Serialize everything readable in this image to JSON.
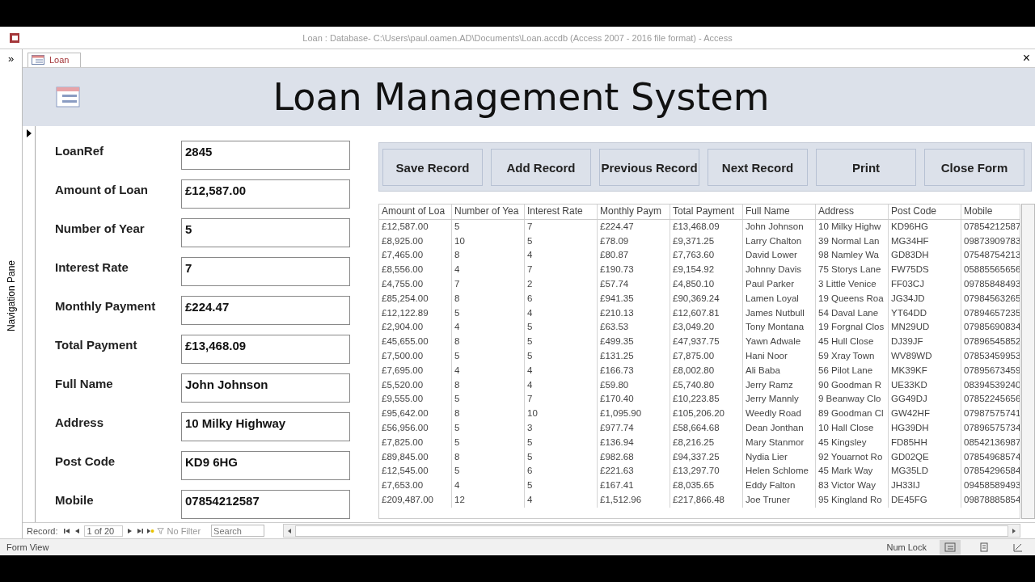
{
  "window": {
    "title": "Loan : Database- C:\\Users\\paul.oamen.AD\\Documents\\Loan.accdb (Access 2007 - 2016 file format) - Access"
  },
  "navigation_pane": {
    "label": "Navigation Pane",
    "toggle": "»"
  },
  "tabs": [
    {
      "label": "Loan",
      "selected": true
    }
  ],
  "close_tab": "×",
  "form": {
    "title": "Loan Management System",
    "fields": [
      {
        "label": "LoanRef",
        "value": "2845"
      },
      {
        "label": "Amount of Loan",
        "value": "£12,587.00"
      },
      {
        "label": "Number of Year",
        "value": "5"
      },
      {
        "label": "Interest Rate",
        "value": "7"
      },
      {
        "label": "Monthly Payment",
        "value": "£224.47"
      },
      {
        "label": "Total Payment",
        "value": "£13,468.09"
      },
      {
        "label": "Full Name",
        "value": "John Johnson"
      },
      {
        "label": "Address",
        "value": "10 Milky Highway"
      },
      {
        "label": "Post Code",
        "value": "KD9 6HG"
      },
      {
        "label": "Mobile",
        "value": "07854212587"
      }
    ],
    "buttons": [
      "Save Record",
      "Add Record",
      "Previous Record",
      "Next Record",
      "Print",
      "Close Form"
    ]
  },
  "table": {
    "columns": [
      "Amount of Loa",
      "Number of Yea",
      "Interest Rate",
      "Monthly Paym",
      "Total Payment",
      "Full Name",
      "Address",
      "Post Code",
      "Mobile"
    ],
    "rows": [
      [
        "£12,587.00",
        "5",
        "7",
        "£224.47",
        "£13,468.09",
        "John Johnson",
        "10 Milky Highw",
        "KD96HG",
        "07854212587"
      ],
      [
        "£8,925.00",
        "10",
        "5",
        "£78.09",
        "£9,371.25",
        "Larry Chalton",
        "39 Normal Lan",
        "MG34HF",
        "09873909783"
      ],
      [
        "£7,465.00",
        "8",
        "4",
        "£80.87",
        "£7,763.60",
        "David Lower",
        "98 Namley Wa",
        "GD83DH",
        "07548754213"
      ],
      [
        "£8,556.00",
        "4",
        "7",
        "£190.73",
        "£9,154.92",
        "Johnny Davis",
        "75 Storys Lane",
        "FW75DS",
        "05885565656"
      ],
      [
        "£4,755.00",
        "7",
        "2",
        "£57.74",
        "£4,850.10",
        "Paul Parker",
        "3 Little Venice",
        "FF03CJ",
        "09785848493"
      ],
      [
        "£85,254.00",
        "8",
        "6",
        "£941.35",
        "£90,369.24",
        "Lamen Loyal",
        "19 Queens Roa",
        "JG34JD",
        "07984563265"
      ],
      [
        "£12,122.89",
        "5",
        "4",
        "£210.13",
        "£12,607.81",
        "James Nutbull",
        "54 Daval Lane",
        "YT64DD",
        "07894657235"
      ],
      [
        "£2,904.00",
        "4",
        "5",
        "£63.53",
        "£3,049.20",
        "Tony Montana",
        "19 Forgnal Clos",
        "MN29UD",
        "07985690834"
      ],
      [
        "£45,655.00",
        "8",
        "5",
        "£499.35",
        "£47,937.75",
        "Yawn Adwale",
        "45 Hull Close",
        "DJ39JF",
        "07896545852"
      ],
      [
        "£7,500.00",
        "5",
        "5",
        "£131.25",
        "£7,875.00",
        "Hani Noor",
        "59 Xray Town",
        "WV89WD",
        "07853459953"
      ],
      [
        "£7,695.00",
        "4",
        "4",
        "£166.73",
        "£8,002.80",
        "Ali Baba",
        "56 Pilot Lane",
        "MK39KF",
        "07895673459"
      ],
      [
        "£5,520.00",
        "8",
        "4",
        "£59.80",
        "£5,740.80",
        "Jerry Ramz",
        "90 Goodman R",
        "UE33KD",
        "08394539240"
      ],
      [
        "£9,555.00",
        "5",
        "7",
        "£170.40",
        "£10,223.85",
        "Jerry Mannly",
        "9 Beanway Clo",
        "GG49DJ",
        "07852245656"
      ],
      [
        "£95,642.00",
        "8",
        "10",
        "£1,095.90",
        "£105,206.20",
        "Weedly Road",
        "89 Goodman Cl",
        "GW42HF",
        "07987575741"
      ],
      [
        "£56,956.00",
        "5",
        "3",
        "£977.74",
        "£58,664.68",
        "Dean Jonthan",
        "10 Hall Close",
        "HG39DH",
        "07896575734"
      ],
      [
        "£7,825.00",
        "5",
        "5",
        "£136.94",
        "£8,216.25",
        "Mary Stanmor",
        "45 Kingsley",
        "FD85HH",
        "08542136987"
      ],
      [
        "£89,845.00",
        "8",
        "5",
        "£982.68",
        "£94,337.25",
        "Nydia Lier",
        "92 Youarnot Ro",
        "GD02QE",
        "07854968574"
      ],
      [
        "£12,545.00",
        "5",
        "6",
        "£221.63",
        "£13,297.70",
        "Helen Schlome",
        "45 Mark Way",
        "MG35LD",
        "07854296584"
      ],
      [
        "£7,653.00",
        "4",
        "5",
        "£167.41",
        "£8,035.65",
        "Eddy Falton",
        "83 Victor Way",
        "JH33IJ",
        "09458589493"
      ],
      [
        "£209,487.00",
        "12",
        "4",
        "£1,512.96",
        "£217,866.48",
        "Joe Truner",
        "95 Kingland Ro",
        "DE45FG",
        "09878885854"
      ]
    ]
  },
  "record_navigation": {
    "label": "Record:",
    "position": "1 of 20",
    "filter": "No Filter",
    "search": {
      "placeholder": "Search"
    }
  },
  "status_bar": {
    "left": "Form View",
    "right": "Num Lock"
  }
}
